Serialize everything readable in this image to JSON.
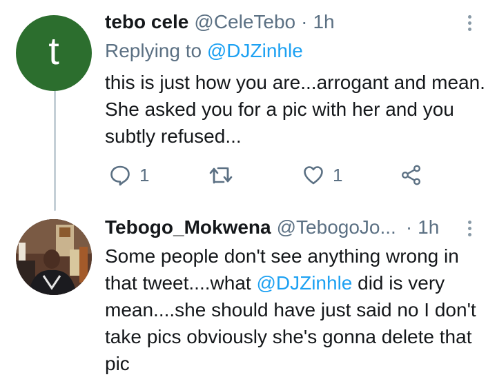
{
  "tweets": [
    {
      "avatar_letter": "t",
      "name": "tebo cele",
      "handle": "@CeleTebo",
      "separator": "·",
      "time": "1h",
      "replying_prefix": "Replying to",
      "replying_to": "@DJZinhle",
      "text": "this is just how you are...arrogant and mean. She asked you for a pic with her and you subtly refused...",
      "reply_count": "1",
      "like_count": "1"
    },
    {
      "name": "Tebogo_Mokwena",
      "handle": "@TebogoJo...",
      "separator": "·",
      "time": "1h",
      "text_before": "Some people don't see anything wrong in that tweet....what",
      "mention": "@DJZinhle",
      "text_after": "did is very mean....she should have just said no I don't take pics obviously she's gonna delete that pic"
    }
  ],
  "colors": {
    "accent": "#1da1f2",
    "secondary_text": "#5b7083",
    "avatar_bg": "#2c6e2e"
  },
  "icons": [
    "reply-icon",
    "retweet-icon",
    "like-icon",
    "share-icon",
    "more-options-icon"
  ]
}
